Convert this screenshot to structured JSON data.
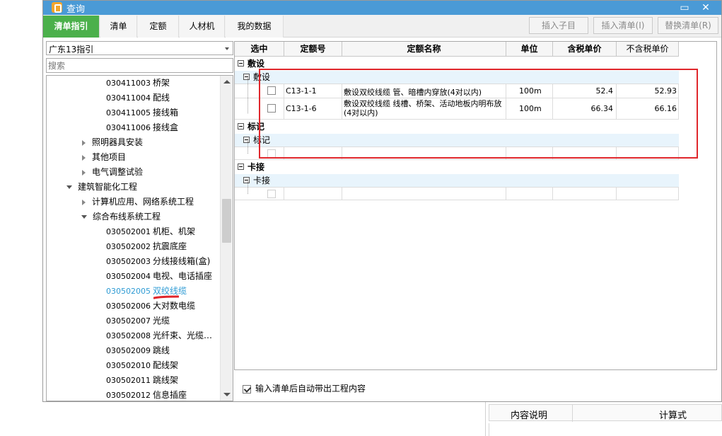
{
  "window": {
    "title": "查询"
  },
  "tabs": [
    {
      "label": "清单指引",
      "active": true
    },
    {
      "label": "清单",
      "active": false
    },
    {
      "label": "定额",
      "active": false
    },
    {
      "label": "人材机",
      "active": false
    },
    {
      "label": "我的数据",
      "active": false
    }
  ],
  "toolbar": {
    "insert_child": "插入子目",
    "insert_list": "插入清单(I)",
    "replace_list": "替换清单(R)"
  },
  "left": {
    "combo_value": "广东13指引",
    "search_placeholder": "搜索",
    "tree": [
      {
        "code": "030411003",
        "name": "桥架",
        "type": "leaf"
      },
      {
        "code": "030411004",
        "name": "配线",
        "type": "leaf"
      },
      {
        "code": "030411005",
        "name": "接线箱",
        "type": "leaf"
      },
      {
        "code": "030411006",
        "name": "接线盒",
        "type": "leaf"
      },
      {
        "name": "照明器具安装",
        "type": "collapsed"
      },
      {
        "name": "其他项目",
        "type": "collapsed"
      },
      {
        "name": "电气调整试验",
        "type": "collapsed"
      },
      {
        "name": "建筑智能化工程",
        "type": "expanded-root"
      },
      {
        "name": "计算机应用、网络系统工程",
        "type": "collapsed"
      },
      {
        "name": "综合布线系统工程",
        "type": "expanded"
      },
      {
        "code": "030502001",
        "name": "机柜、机架",
        "type": "leaf"
      },
      {
        "code": "030502002",
        "name": "抗震底座",
        "type": "leaf"
      },
      {
        "code": "030502003",
        "name": "分线接线箱(盒)",
        "type": "leaf"
      },
      {
        "code": "030502004",
        "name": "电视、电话插座",
        "type": "leaf"
      },
      {
        "code": "030502005",
        "name": "双绞线缆",
        "type": "leaf",
        "selected": true
      },
      {
        "code": "030502006",
        "name": "大对数电缆",
        "type": "leaf"
      },
      {
        "code": "030502007",
        "name": "光缆",
        "type": "leaf"
      },
      {
        "code": "030502008",
        "name": "光纤束、光缆…",
        "type": "leaf"
      },
      {
        "code": "030502009",
        "name": "跳线",
        "type": "leaf"
      },
      {
        "code": "030502010",
        "name": "配线架",
        "type": "leaf"
      },
      {
        "code": "030502011",
        "name": "跳线架",
        "type": "leaf"
      },
      {
        "code": "030502012",
        "name": "信息插座",
        "type": "leaf"
      }
    ]
  },
  "grid": {
    "columns": [
      "选中",
      "定额号",
      "定额名称",
      "单位",
      "含税单价",
      "不含税单价"
    ],
    "groups": [
      {
        "name": "敷设",
        "sub": "敷设",
        "rows": [
          {
            "code": "C13-1-1",
            "name": "敷设双绞线缆 管、暗槽内穿放(4对以内)",
            "unit": "100m",
            "price_tax": "52.4",
            "price_notax": "52.93"
          },
          {
            "code": "C13-1-6",
            "name": "敷设双绞线缆 线槽、桥架、活动地板内明布放(4对以内)",
            "unit": "100m",
            "price_tax": "66.34",
            "price_notax": "66.16"
          }
        ]
      },
      {
        "name": "标记",
        "sub": "标记",
        "rows": []
      },
      {
        "name": "卡接",
        "sub": "卡接",
        "rows": []
      }
    ]
  },
  "auto_option": "输入清单后自动带出工程内容",
  "bottom_panel": {
    "col1": "内容说明",
    "col2": "计算式"
  },
  "colors": {
    "title_bar": "#4a9ad6",
    "active_tab": "#4bb04b",
    "selected_text": "#2e9bd4",
    "annotation": "#e0272c"
  }
}
